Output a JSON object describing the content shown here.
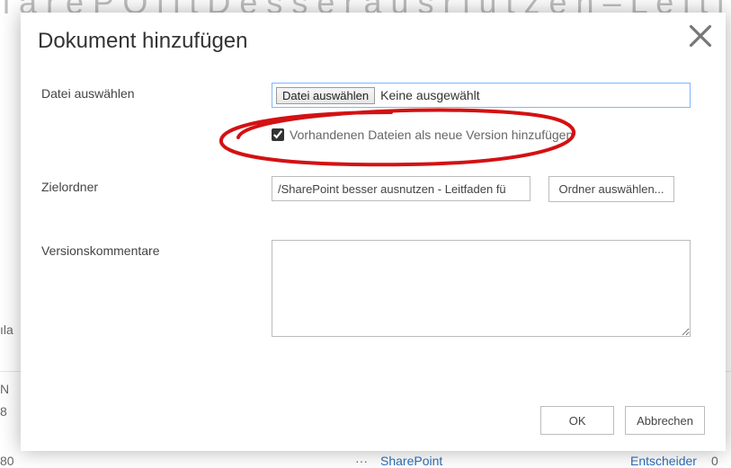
{
  "background": {
    "partial_title": "l a r e P O l l t  D e s s e r  a u s r l u t z e n  –  L e l t l a u e r l  l u l",
    "ila": "ıla",
    "n": "N",
    "eight": "8",
    "eighty": "80",
    "dots": "···",
    "link1": "SharePoint",
    "link2": "Entscheider",
    "zero": "0"
  },
  "dialog": {
    "title": "Dokument hinzufügen",
    "labels": {
      "file": "Datei auswählen",
      "dest": "Zielordner",
      "comments": "Versionskommentare"
    },
    "file": {
      "button": "Datei auswählen",
      "status": "Keine ausgewählt"
    },
    "checkbox": {
      "label": "Vorhandenen Dateien als neue Version hinzufügen",
      "checked": true
    },
    "dest": {
      "value": "/SharePoint besser ausnutzen - Leitfaden fü",
      "browse": "Ordner auswählen..."
    },
    "comments": {
      "value": ""
    },
    "buttons": {
      "ok": "OK",
      "cancel": "Abbrechen"
    }
  },
  "annotation": {
    "color": "#d31113"
  }
}
